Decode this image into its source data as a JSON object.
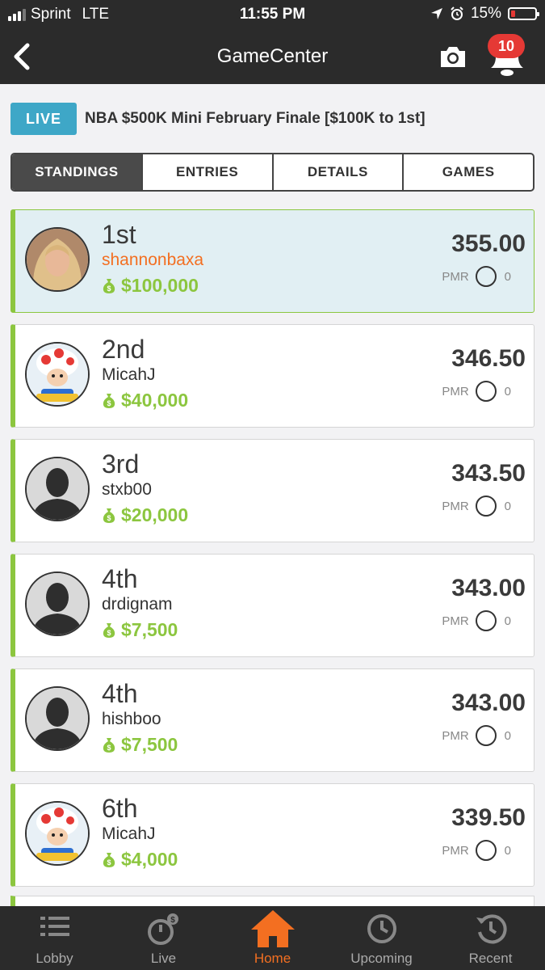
{
  "status_bar": {
    "carrier": "Sprint",
    "network": "LTE",
    "time": "11:55 PM",
    "battery": "15%"
  },
  "nav": {
    "title": "GameCenter",
    "notification_count": "10"
  },
  "contest": {
    "status": "LIVE",
    "name": "NBA $500K Mini February Finale [$100K to 1st]"
  },
  "tabs": [
    "STANDINGS",
    "ENTRIES",
    "DETAILS",
    "GAMES"
  ],
  "active_tab": "STANDINGS",
  "pmr_label": "PMR",
  "standings": [
    {
      "rank": "1st",
      "username": "shannonbaxa",
      "prize": "$100,000",
      "score": "355.00",
      "pmr": "0",
      "avatar": "photo-avatar",
      "highlight": true
    },
    {
      "rank": "2nd",
      "username": "MicahJ",
      "prize": "$40,000",
      "score": "346.50",
      "pmr": "0",
      "avatar": "toad-avatar"
    },
    {
      "rank": "3rd",
      "username": "stxb00",
      "prize": "$20,000",
      "score": "343.50",
      "pmr": "0",
      "avatar": "default-avatar"
    },
    {
      "rank": "4th",
      "username": "drdignam",
      "prize": "$7,500",
      "score": "343.00",
      "pmr": "0",
      "avatar": "default-avatar"
    },
    {
      "rank": "4th",
      "username": "hishboo",
      "prize": "$7,500",
      "score": "343.00",
      "pmr": "0",
      "avatar": "default-avatar"
    },
    {
      "rank": "6th",
      "username": "MicahJ",
      "prize": "$4,000",
      "score": "339.50",
      "pmr": "0",
      "avatar": "toad-avatar"
    }
  ],
  "bottom_nav": [
    {
      "label": "Lobby",
      "icon": "list-icon"
    },
    {
      "label": "Live",
      "icon": "stopwatch-money-icon"
    },
    {
      "label": "Home",
      "icon": "home-icon",
      "active": true
    },
    {
      "label": "Upcoming",
      "icon": "clock-icon"
    },
    {
      "label": "Recent",
      "icon": "history-icon"
    }
  ],
  "colors": {
    "accent_green": "#8cc63f",
    "accent_orange": "#f36f21",
    "live_blue": "#3ea7c7",
    "highlight_row": "#e1eff3",
    "dark_bar": "#2b2b2b"
  }
}
